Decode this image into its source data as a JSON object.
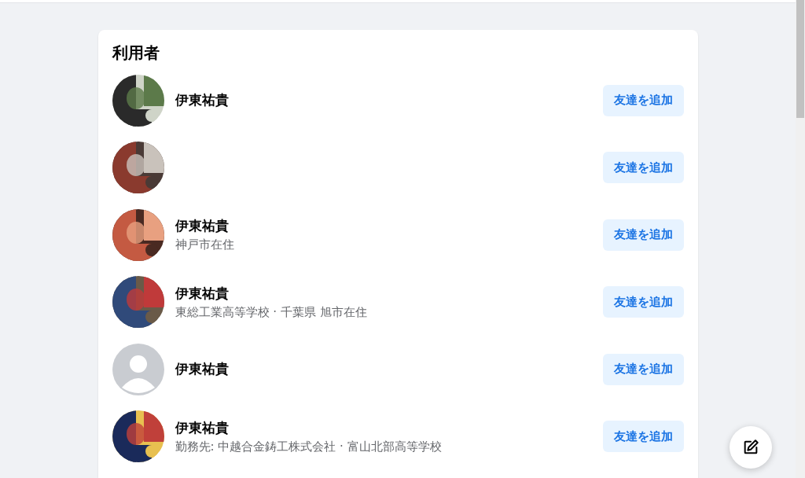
{
  "section": {
    "title": "利用者"
  },
  "people": [
    {
      "name": "伊東祐貴",
      "kind": "picture",
      "action": "友達を追加"
    },
    {
      "kind": "picture",
      "action": "友達を追加"
    },
    {
      "name": "伊東祐貴",
      "detail": "神戸市在住",
      "kind": "picture",
      "action": "友達を追加"
    },
    {
      "name": "伊東祐貴",
      "detail": "東総工業高等学校 · 千葉県 旭市在住",
      "kind": "picture",
      "action": "友達を追加"
    },
    {
      "name": "伊東祐貴",
      "kind": "default",
      "action": "友達を追加"
    },
    {
      "name": "伊東祐貴",
      "detail": "勤務先: 中越合金鋳工株式会社 · 富山北部高等学校",
      "kind": "picture",
      "action": "友達を追加"
    }
  ]
}
